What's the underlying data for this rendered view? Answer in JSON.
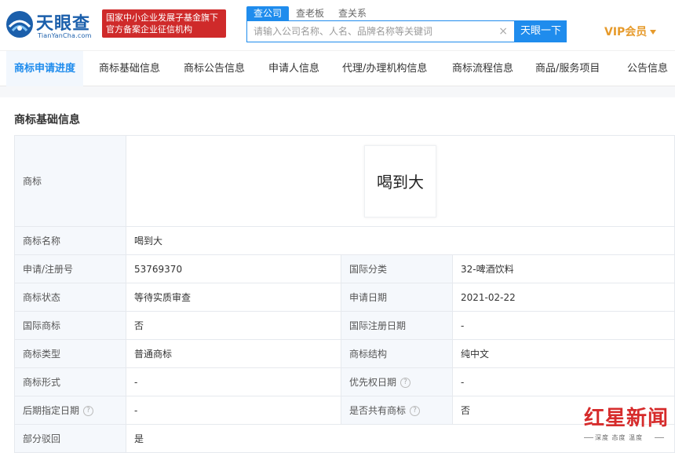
{
  "header": {
    "logo_title": "天眼查",
    "logo_sub": "TianYanCha.com",
    "badge_line1": "国家中小企业发展子基金旗下",
    "badge_line2": "官方备案企业征信机构",
    "search_tabs": [
      "查公司",
      "查老板",
      "查关系"
    ],
    "search_placeholder": "请输入公司名称、人名、品牌名称等关键词",
    "clear_symbol": "×",
    "search_button": "天眼一下",
    "vip_label": "VIP会员"
  },
  "nav": {
    "tabs": [
      "商标申请进度",
      "商标基础信息",
      "商标公告信息",
      "申请人信息",
      "代理/办理机构信息",
      "商标流程信息",
      "商品/服务项目",
      "公告信息"
    ]
  },
  "section": {
    "title": "商标基础信息"
  },
  "table": {
    "trademark_label": "商标",
    "trademark_text": "喝到大",
    "rows": [
      {
        "l1": "商标名称",
        "v1": "喝到大"
      },
      {
        "l1": "申请/注册号",
        "v1": "53769370",
        "l2": "国际分类",
        "v2": "32-啤酒饮料"
      },
      {
        "l1": "商标状态",
        "v1": "等待实质审查",
        "l2": "申请日期",
        "v2": "2021-02-22"
      },
      {
        "l1": "国际商标",
        "v1": "否",
        "l2": "国际注册日期",
        "v2": "-"
      },
      {
        "l1": "商标类型",
        "v1": "普通商标",
        "l2": "商标结构",
        "v2": "纯中文"
      },
      {
        "l1": "商标形式",
        "v1": "-",
        "l2": "优先权日期",
        "v2": "-"
      },
      {
        "l1": "后期指定日期",
        "v1": "-",
        "l2": "是否共有商标",
        "v2": "否"
      },
      {
        "l1": "部分驳回",
        "v1": "是"
      }
    ]
  },
  "help_symbol": "?",
  "watermark": {
    "main": "红星新闻",
    "sub": "深度 态度 温度"
  },
  "colors": {
    "brand_blue": "#1f8ced",
    "badge_red": "#cf2a2a",
    "vip_gold": "#e69a2b"
  }
}
